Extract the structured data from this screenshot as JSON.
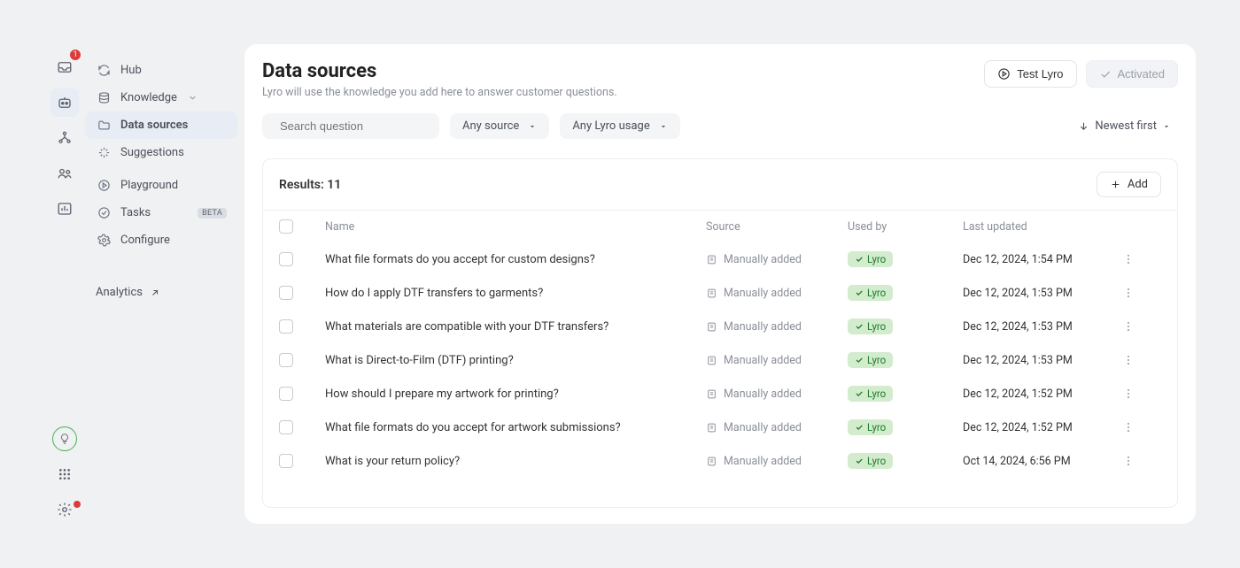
{
  "rail": {
    "badge": "1"
  },
  "sidebar": {
    "items": [
      {
        "icon": "refresh",
        "label": "Hub"
      },
      {
        "icon": "database",
        "label": "Knowledge",
        "chevron": true
      },
      {
        "icon": "folder",
        "label": "Data sources",
        "active": true
      },
      {
        "icon": "sparkle",
        "label": "Suggestions"
      },
      {
        "icon": "play",
        "label": "Playground"
      },
      {
        "icon": "check",
        "label": "Tasks",
        "badge": "BETA"
      },
      {
        "icon": "gear",
        "label": "Configure"
      }
    ],
    "analytics": "Analytics"
  },
  "header": {
    "title": "Data sources",
    "subtitle": "Lyro will use the knowledge you add here to answer customer questions.",
    "testButton": "Test Lyro",
    "activatedButton": "Activated"
  },
  "filters": {
    "searchPlaceholder": "Search question",
    "sourceFilter": "Any source",
    "usageFilter": "Any Lyro usage",
    "sort": "Newest first"
  },
  "results": {
    "label": "Results:",
    "count": "11",
    "addButton": "Add"
  },
  "columns": {
    "name": "Name",
    "source": "Source",
    "usedBy": "Used by",
    "updated": "Last updated"
  },
  "sourceType": "Manually added",
  "tag": "Lyro",
  "rows": [
    {
      "name": "What file formats do you accept for custom designs?",
      "updated": "Dec 12, 2024, 1:54 PM"
    },
    {
      "name": "How do I apply DTF transfers to garments?",
      "updated": "Dec 12, 2024, 1:53 PM"
    },
    {
      "name": "What materials are compatible with your DTF transfers?",
      "updated": "Dec 12, 2024, 1:53 PM"
    },
    {
      "name": "What is Direct-to-Film (DTF) printing?",
      "updated": "Dec 12, 2024, 1:53 PM"
    },
    {
      "name": "How should I prepare my artwork for printing?",
      "updated": "Dec 12, 2024, 1:52 PM"
    },
    {
      "name": "What file formats do you accept for artwork submissions?",
      "updated": "Dec 12, 2024, 1:52 PM"
    },
    {
      "name": "What is your return policy?",
      "updated": "Oct 14, 2024, 6:56 PM"
    }
  ]
}
